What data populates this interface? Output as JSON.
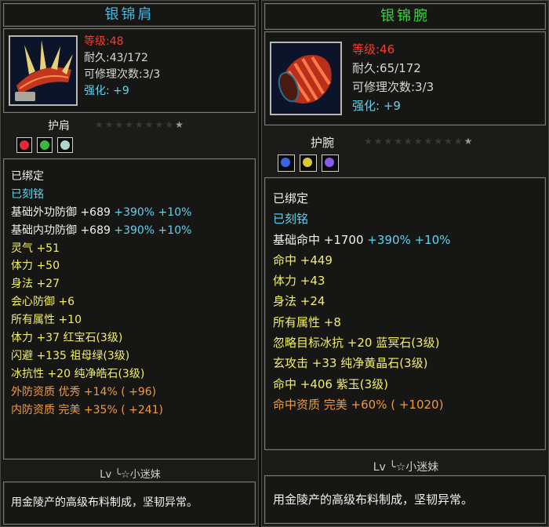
{
  "left": {
    "name": "银锦肩",
    "level": "等级:48",
    "durability": "耐久:43/172",
    "repairs": "可修理次数:3/3",
    "enhance": "强化: +9",
    "slot": "护肩",
    "attrs": [
      {
        "text": "已绑定",
        "color": "white"
      },
      {
        "text": "已刻铭",
        "color": "cyan"
      },
      {
        "text": "基础外功防御 +689",
        "extra": " +390% +10%",
        "color": "white",
        "extra_color": "cyan"
      },
      {
        "text": "基础内功防御 +689",
        "extra": " +390% +10%",
        "color": "white",
        "extra_color": "cyan"
      },
      {
        "text": "灵气 +51",
        "color": "yellow"
      },
      {
        "text": "体力 +50",
        "color": "yellow"
      },
      {
        "text": "身法 +27",
        "color": "yellow"
      },
      {
        "text": "会心防御 +6",
        "color": "yellow"
      },
      {
        "text": "所有属性 +10",
        "color": "yellow"
      },
      {
        "text": "体力 +37 红宝石(3级)",
        "color": "yellow"
      },
      {
        "text": "闪避 +135 祖母绿(3级)",
        "color": "yellow"
      },
      {
        "text": "冰抗性 +20 纯净皓石(3级)",
        "color": "yellow"
      },
      {
        "text": "外防资质  优秀 +14% ( +96)",
        "color": "orange"
      },
      {
        "text": "内防资质  完美 +35% ( +241)",
        "color": "orange"
      }
    ],
    "signature": "Lv ╰☆小迷妹",
    "description": "用金陵产的高级布料制成，坚韧异常。"
  },
  "right": {
    "name": "银锦腕",
    "level": "等级:46",
    "durability": "耐久:65/172",
    "repairs": "可修理次数:3/3",
    "enhance": "强化: +9",
    "slot": "护腕",
    "attrs": [
      {
        "text": "已绑定",
        "color": "white"
      },
      {
        "text": "已刻铭",
        "color": "cyan"
      },
      {
        "text": "基础命中 +1700",
        "extra": " +390% +10%",
        "color": "white",
        "extra_color": "cyan"
      },
      {
        "text": "命中 +449",
        "color": "yellow"
      },
      {
        "text": "体力 +43",
        "color": "yellow"
      },
      {
        "text": "身法 +24",
        "color": "yellow"
      },
      {
        "text": "所有属性 +8",
        "color": "yellow"
      },
      {
        "text": "忽略目标冰抗 +20 蓝冥石(3级)",
        "color": "yellow"
      },
      {
        "text": "玄攻击 +33 纯净黄晶石(3级)",
        "color": "yellow"
      },
      {
        "text": "命中 +406 紫玉(3级)",
        "color": "yellow"
      },
      {
        "text": "命中资质  完美 +60% ( +1020)",
        "color": "orange"
      }
    ],
    "signature": "Lv ╰☆小迷妹",
    "description": "用金陵产的高级布料制成，坚韧异常。"
  },
  "colors": {
    "left_title": "#4ab8e0",
    "right_title": "#3ed43e",
    "level": "#ff3a2a",
    "stat": "#d8d8d0",
    "attr": "#f2ef6a",
    "quality": "#f29a3a",
    "engraved": "#5fd4f2"
  }
}
